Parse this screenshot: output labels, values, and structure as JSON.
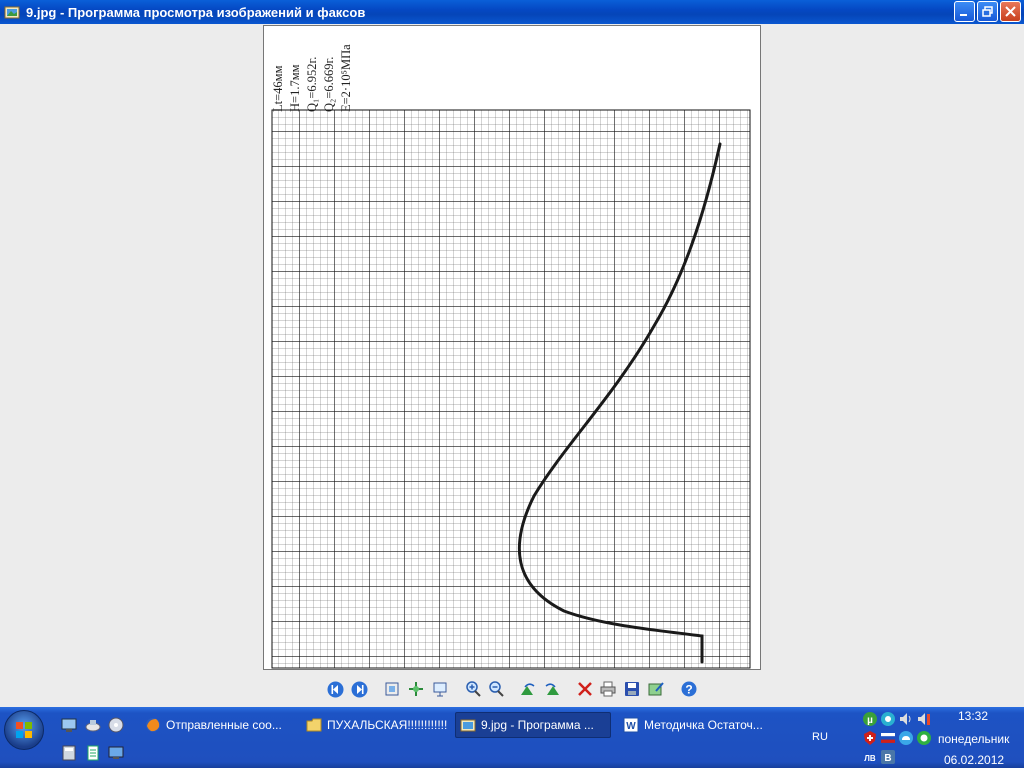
{
  "window": {
    "title": "9.jpg - Программа просмотра изображений и факсов"
  },
  "image": {
    "params": [
      "Lt=46мм",
      "H=1.7мм",
      "Q₁=6.952г.",
      "Q₂=6.669г.",
      "E=2·10⁵МПа"
    ]
  },
  "toolbar": {
    "icons": [
      "prev-image-icon",
      "next-image-icon",
      "best-fit-icon",
      "actual-size-icon",
      "slideshow-icon",
      "zoom-in-icon",
      "zoom-out-icon",
      "rotate-clockwise-icon",
      "rotate-counterclockwise-icon",
      "delete-icon",
      "print-icon",
      "save-icon",
      "edit-icon",
      "help-icon"
    ]
  },
  "taskbar": {
    "tasks": [
      {
        "label": "Отправленные соо...",
        "icon": "firefox-icon"
      },
      {
        "label": "ПУХАЛЬСКАЯ!!!!!!!!!!!!",
        "icon": "folder-icon"
      },
      {
        "label": "9.jpg - Программа ...",
        "icon": "image-viewer-icon",
        "active": true
      },
      {
        "label": "Методичка Остаточ...",
        "icon": "word-icon"
      }
    ],
    "language": "RU",
    "clock": {
      "time": "13:32",
      "day": "понедельник",
      "date": "06.02.2012"
    },
    "colors": {
      "taskbar": "#1f4fbe",
      "active_task": "#1a3f95"
    }
  }
}
